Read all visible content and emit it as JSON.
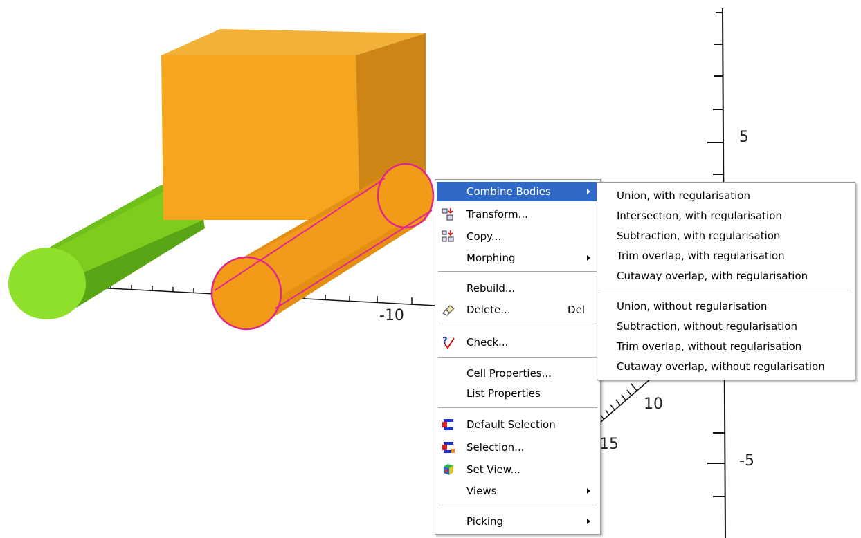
{
  "axes": {
    "labels": [
      "5",
      "-10",
      "10",
      "15",
      "-5"
    ]
  },
  "scene": {
    "colors": {
      "box": "#f5a41c",
      "cylinder_selected": "#f39a18",
      "cylinder_green": "#8ad61f",
      "selection_outline": "#e0278a"
    }
  },
  "context_menu": {
    "items": [
      {
        "label": "Combine Bodies",
        "submenu": true,
        "highlighted": true
      },
      {
        "label": "Transform...",
        "icon": "transform-icon"
      },
      {
        "label": "Copy...",
        "icon": "copy-icon"
      },
      {
        "label": "Morphing",
        "submenu": true
      },
      {
        "label": "Rebuild..."
      },
      {
        "label": "Delete...",
        "shortcut": "Del",
        "icon": "eraser-icon"
      },
      {
        "label": "Check...",
        "icon": "check-icon"
      },
      {
        "label": "Cell Properties..."
      },
      {
        "label": "List Properties"
      },
      {
        "label": "Default Selection",
        "icon": "selection-icon"
      },
      {
        "label": "Selection...",
        "icon": "selection-icon"
      },
      {
        "label": "Set View...",
        "icon": "view-cube-icon"
      },
      {
        "label": "Views",
        "submenu": true
      },
      {
        "label": "Picking",
        "submenu": true
      }
    ]
  },
  "submenu": {
    "items": [
      "Union, with regularisation",
      "Intersection, with regularisation",
      "Subtraction, with regularisation",
      "Trim overlap, with regularisation",
      "Cutaway overlap, with regularisation",
      "Union, without regularisation",
      "Subtraction, without regularisation",
      "Trim overlap, without regularisation",
      "Cutaway overlap, without regularisation"
    ]
  }
}
